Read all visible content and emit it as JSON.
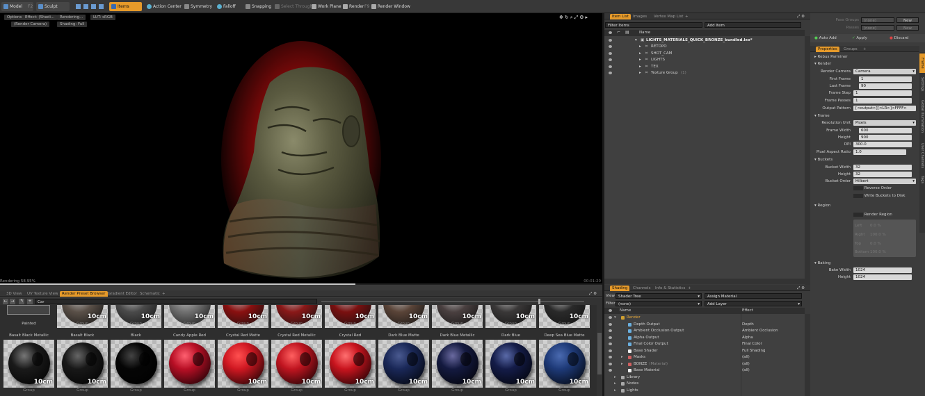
{
  "toolbar": {
    "model": "Model",
    "f2": "F2",
    "sculpt": "Sculpt",
    "items": "Items",
    "action_center": "Action Center",
    "symmetry": "Symmetry",
    "falloff": "Falloff",
    "snapping": "Snapping",
    "select_through": "Select Through",
    "work_plane": "Work Plane",
    "render": "Render",
    "render_shortcut": "F9",
    "render_window": "Render Window"
  },
  "viewport": {
    "options": "Options",
    "effect": "Effect: (Shadi...",
    "rendering": "Rendering...",
    "lut": "LUT: sRGB",
    "camera": "(Render Camera)",
    "shading": "Shading: Full",
    "status_left": "Rendering",
    "status_percent": "58.95%",
    "progress": 0.59,
    "time": "00:01:20"
  },
  "itemlist": {
    "tabs": [
      "Item List",
      "Images",
      "Vertex Map List",
      "+"
    ],
    "filter": "Filter Items",
    "add_item": "Add Item",
    "col_name": "Name",
    "root": "LIGHTS_MATERIALS_QUICK_BRONZE_bundled.lxo*",
    "children": [
      {
        "name": "RETOPO"
      },
      {
        "name": "SHOT_CAM"
      },
      {
        "name": "LIGHTS"
      },
      {
        "name": "TEX"
      },
      {
        "name": "Texture Group",
        "count": "(1)"
      }
    ]
  },
  "rightpanel": {
    "pass_groups": "Pass Groups",
    "pass_groups_val": "(none)",
    "passes": "Passes",
    "passes_val": "(none)",
    "new": "New",
    "auto_add": "Auto Add",
    "apply": "Apply",
    "discard": "Discard",
    "tabs": [
      "Properties",
      "Groups",
      "+"
    ],
    "vtabs": [
      "Frame",
      "Settings",
      "Global Illumination",
      "User Channels",
      "Tags"
    ],
    "rebus": "Rebus Parminer",
    "render_sec": "Render",
    "render_camera_label": "Render Camera",
    "render_camera": "Camera",
    "first_frame_label": "First Frame",
    "first_frame": "1",
    "last_frame_label": "Last Frame",
    "last_frame": "90",
    "frame_step_label": "Frame Step",
    "frame_step": "1",
    "frame_passes_label": "Frame Passes",
    "frame_passes": "1",
    "output_pattern_label": "Output Pattern",
    "output_pattern": "[<output>][<LR>]<FFFF>",
    "frame_sec": "Frame",
    "res_unit_label": "Resolution Unit",
    "res_unit": "Pixels",
    "frame_width_label": "Frame Width",
    "frame_width": "600",
    "height_label": "Height",
    "height": "900",
    "dpi_label": "DPI",
    "dpi": "300.0",
    "pixel_aspect_label": "Pixel Aspect Ratio",
    "pixel_aspect": "1.0",
    "buckets_sec": "Buckets",
    "bucket_width_label": "Bucket Width",
    "bucket_width": "32",
    "bucket_height_label": "Height",
    "bucket_height": "32",
    "bucket_order_label": "Bucket Order",
    "bucket_order": "Hilbert",
    "reverse_order": "Reverse Order",
    "write_buckets": "Write Buckets to Disk",
    "region_sec": "Region",
    "render_region": "Render Region",
    "region_left": "Left",
    "region_right": "Right",
    "region_top": "Top",
    "region_bottom": "Bottom",
    "region_left_val": "0.0 %",
    "region_right_val": "100.0 %",
    "region_top_val": "0.0 %",
    "region_bottom_val": "100.0 %",
    "baking_sec": "Baking",
    "bake_width_label": "Bake Width",
    "bake_width": "1024",
    "bake_height_label": "Height",
    "bake_height": "1024"
  },
  "bottomtabs": {
    "tabs": [
      "3D View",
      "UV Texture View",
      "Render Preset Browser",
      "Gradient Editor",
      "Schematic",
      "+"
    ],
    "path": "Car"
  },
  "presets": {
    "top_row": [
      {
        "title": "Painted",
        "cm": "",
        "group": ""
      },
      {
        "title": "",
        "cm": "10cm",
        "group": "Group"
      },
      {
        "title": "",
        "cm": "10cm",
        "group": "Group"
      },
      {
        "title": "",
        "cm": "10cm",
        "group": "Group"
      },
      {
        "title": "",
        "cm": "10cm",
        "group": "Group"
      },
      {
        "title": "",
        "cm": "10cm",
        "group": "Group"
      },
      {
        "title": "",
        "cm": "10cm",
        "group": "Group"
      },
      {
        "title": "",
        "cm": "10cm",
        "group": "Group"
      },
      {
        "title": "",
        "cm": "10cm",
        "group": "Group"
      },
      {
        "title": "",
        "cm": "10cm",
        "group": "Group"
      },
      {
        "title": "",
        "cm": "10cm",
        "group": "Group"
      }
    ],
    "top_colors": [
      "#3a3a3a",
      "#5a5048",
      "#4a4a4a",
      "#707070",
      "#8a1010",
      "#8a1818",
      "#7a1010",
      "#5a4438",
      "#4a4040",
      "#3a3838",
      "#2a2a2a"
    ],
    "bottom_row": [
      {
        "title": "Basalt Black Metallic",
        "cm": "10cm",
        "group": "Group",
        "color": "#1a1a1a",
        "hi": "#777777"
      },
      {
        "title": "Basalt Black",
        "cm": "10cm",
        "group": "Group",
        "color": "#181818",
        "hi": "#666666"
      },
      {
        "title": "Black",
        "cm": "",
        "group": "Group",
        "color": "#050505",
        "hi": "#444444"
      },
      {
        "title": "Candy Apple Red",
        "cm": "",
        "group": "Group",
        "color": "#b80f25",
        "hi": "#ff6070"
      },
      {
        "title": "Crystal Red Matte",
        "cm": "10cm",
        "group": "Group",
        "color": "#d01822",
        "hi": "#ff5050"
      },
      {
        "title": "Crystal Red Metallic",
        "cm": "10cm",
        "group": "Group",
        "color": "#c01520",
        "hi": "#ff6060"
      },
      {
        "title": "Crystal Red",
        "cm": "10cm",
        "group": "Group",
        "color": "#c8141e",
        "hi": "#ff7070"
      },
      {
        "title": "Dark Blue Matte",
        "cm": "10cm",
        "group": "Group",
        "color": "#1a2858",
        "hi": "#4a5a90"
      },
      {
        "title": "Dark Blue Metallic",
        "cm": "10cm",
        "group": "Group",
        "color": "#141a40",
        "hi": "#6a6aa0"
      },
      {
        "title": "Dark Blue",
        "cm": "10cm",
        "group": "Group",
        "color": "#141c48",
        "hi": "#5a6aa8"
      },
      {
        "title": "Deep Sea Blue Matte",
        "cm": "10cm",
        "group": "Group",
        "color": "#1e3a78",
        "hi": "#4a6ab0"
      }
    ]
  },
  "shading": {
    "tabs": [
      "Shading",
      "Channels",
      "Info & Statistics",
      "+"
    ],
    "view_label": "View",
    "view": "Shader Tree",
    "assign_material": "Assign Material",
    "filter_label": "Filter",
    "filter": "(none)",
    "add_layer": "Add Layer",
    "col_name": "Name",
    "col_effect": "Effect",
    "rows": [
      {
        "name": "Render",
        "effect": "",
        "indent": 0
      },
      {
        "name": "Depth Output",
        "effect": "Depth",
        "indent": 1
      },
      {
        "name": "Ambient Occlusion Output",
        "effect": "Ambient Occlusion",
        "indent": 1
      },
      {
        "name": "Alpha Output",
        "effect": "Alpha",
        "indent": 1
      },
      {
        "name": "Final Color Output",
        "effect": "Final Color",
        "indent": 1
      },
      {
        "name": "Base Shader",
        "effect": "Full Shading",
        "indent": 1
      },
      {
        "name": "Masks",
        "effect": "(all)",
        "indent": 1
      },
      {
        "name": "BONZE",
        "tag": "(Material)",
        "effect": "(all)",
        "indent": 1
      },
      {
        "name": "Base Material",
        "effect": "(all)",
        "indent": 1
      },
      {
        "name": "Library",
        "effect": "",
        "indent": 0
      },
      {
        "name": "Nodes",
        "effect": "",
        "indent": 0
      },
      {
        "name": "Lights",
        "effect": "",
        "indent": 0
      }
    ]
  }
}
